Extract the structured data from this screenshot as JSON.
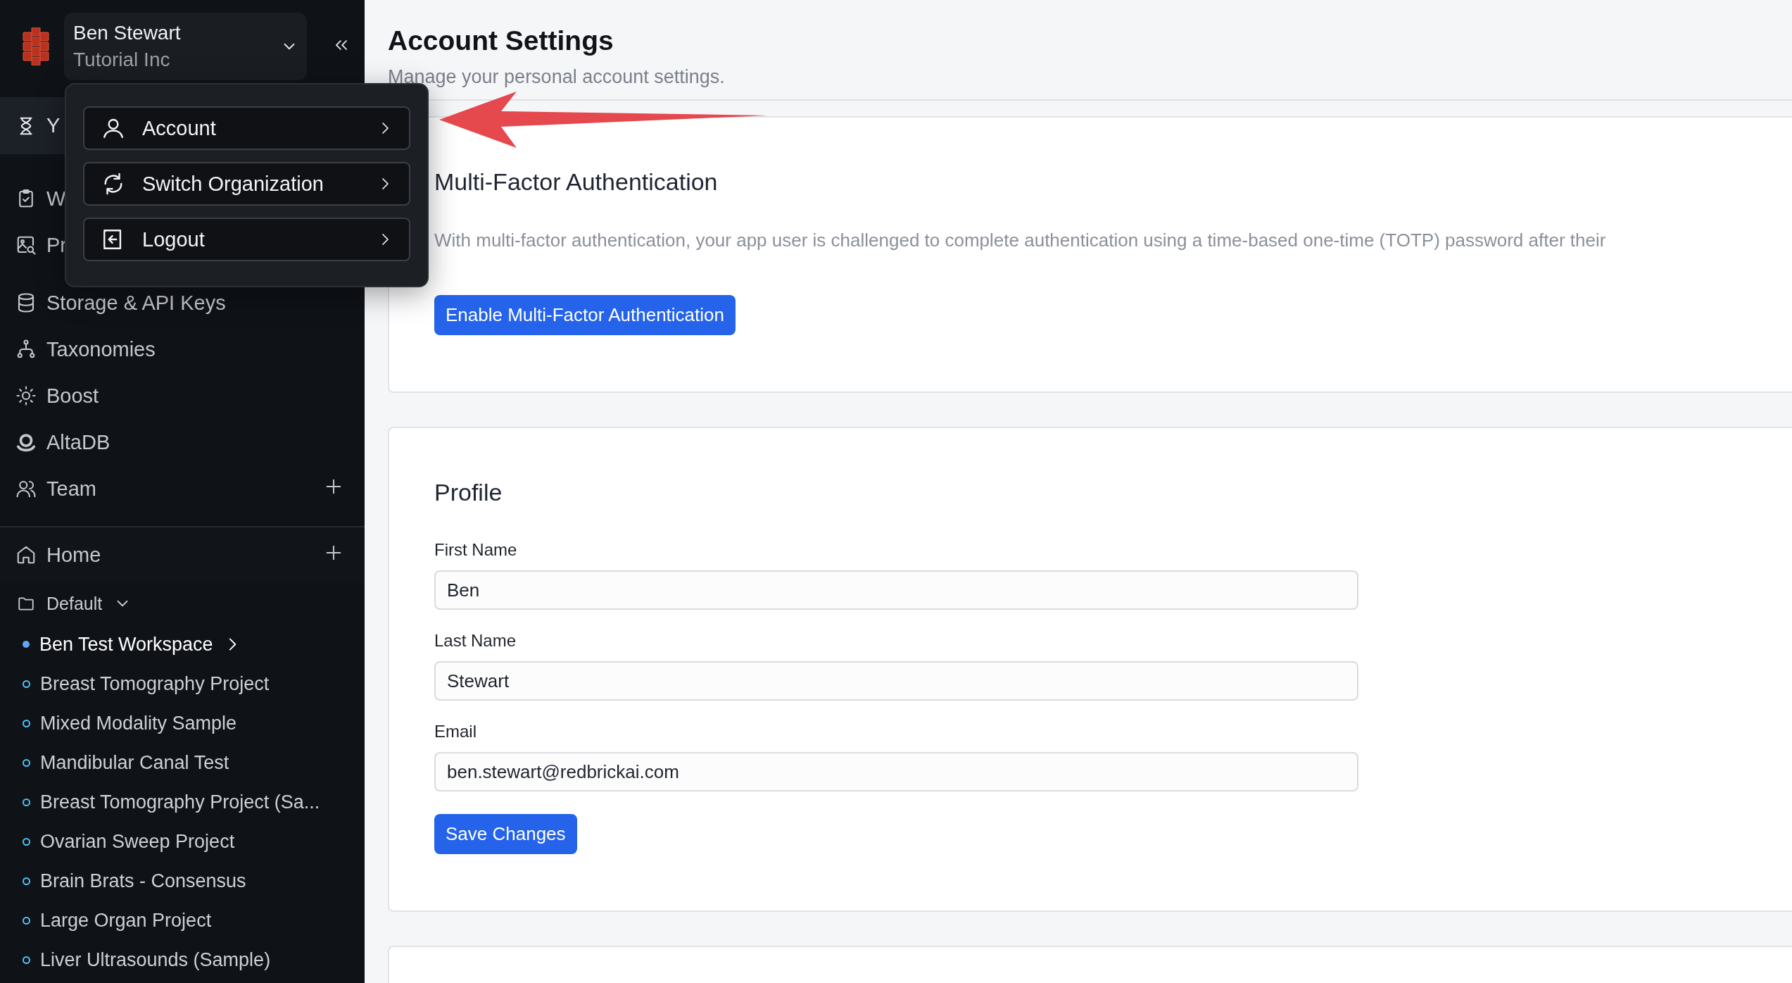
{
  "account_switcher": {
    "name": "Ben Stewart",
    "organization": "Tutorial Inc"
  },
  "sidebar": {
    "nav_items": [
      {
        "label": "Y",
        "selected": true,
        "add": false
      },
      {
        "label": "W",
        "selected": false,
        "add": false
      },
      {
        "label": "Pr",
        "selected": false,
        "add": false
      },
      {
        "label": "Storage & API Keys",
        "selected": false,
        "add": false
      },
      {
        "label": "Taxonomies",
        "selected": false,
        "add": false
      },
      {
        "label": "Boost",
        "selected": false,
        "add": false
      },
      {
        "label": "AltaDB",
        "selected": false,
        "add": false
      },
      {
        "label": "Team",
        "selected": false,
        "add": true
      }
    ],
    "home": {
      "label": "Home",
      "add": true
    },
    "folder": {
      "label": "Default",
      "expanded": true
    },
    "projects": [
      {
        "label": "Ben Test Workspace",
        "selected": true
      },
      {
        "label": "Breast Tomography Project",
        "selected": false
      },
      {
        "label": "Mixed Modality Sample",
        "selected": false
      },
      {
        "label": "Mandibular Canal Test",
        "selected": false
      },
      {
        "label": "Breast Tomography Project (Sa...",
        "selected": false
      },
      {
        "label": "Ovarian Sweep Project",
        "selected": false
      },
      {
        "label": "Brain Brats - Consensus",
        "selected": false
      },
      {
        "label": "Large Organ Project",
        "selected": false
      },
      {
        "label": "Liver Ultrasounds (Sample)",
        "selected": false
      }
    ]
  },
  "account_menu": [
    {
      "label": "Account"
    },
    {
      "label": "Switch Organization"
    },
    {
      "label": "Logout"
    }
  ],
  "page": {
    "title": "Account Settings",
    "subtitle": "Manage your personal account settings."
  },
  "mfa": {
    "title": "Multi-Factor Authentication",
    "description": "With multi-factor authentication, your app user is challenged to complete authentication using a time-based one-time (TOTP) password after their",
    "button": "Enable Multi-Factor Authentication"
  },
  "profile": {
    "title": "Profile",
    "fields": [
      {
        "label": "First Name",
        "value": "Ben"
      },
      {
        "label": "Last Name",
        "value": "Stewart"
      },
      {
        "label": "Email",
        "value": "ben.stewart@redbrickai.com"
      }
    ],
    "button": "Save Changes"
  }
}
